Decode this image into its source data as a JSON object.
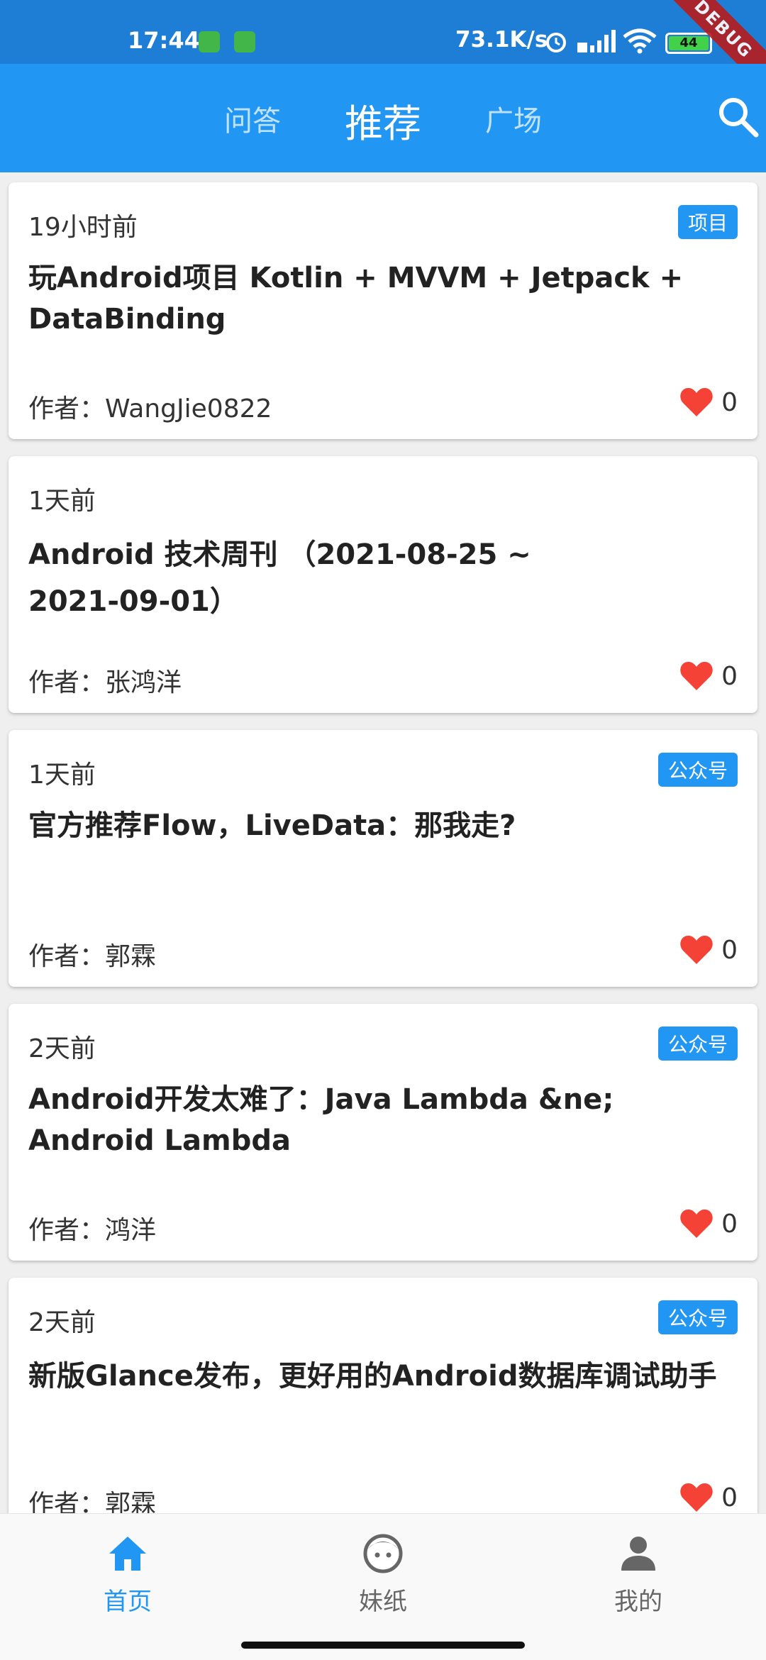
{
  "status_bar": {
    "time": "17:44",
    "network_speed": "73.1K/s",
    "battery": "44",
    "debug_label": "DEBUG"
  },
  "app_bar": {
    "tabs": [
      {
        "label": "问答"
      },
      {
        "label": "推荐"
      },
      {
        "label": "广场"
      }
    ],
    "active_tab": "推荐",
    "search_icon": "search-icon"
  },
  "articles": [
    {
      "time": "19小时前",
      "tag": "项目",
      "title": "玩Android项目 Kotlin + MVVM + Jetpack + DataBinding",
      "author": "作者：WangJie0822",
      "likes": "0"
    },
    {
      "time": "1天前",
      "tag": "",
      "title": "Android 技术周刊 （2021-08-25 ~ 2021-09-01）",
      "author": "作者：张鸿洋",
      "likes": "0"
    },
    {
      "time": "1天前",
      "tag": "公众号",
      "title": "官方推荐Flow，LiveData：那我走?",
      "author": "作者：郭霖",
      "likes": "0"
    },
    {
      "time": "2天前",
      "tag": "公众号",
      "title": "Android开发太难了：Java Lambda &ne; Android Lambda",
      "author": "作者：鸿洋",
      "likes": "0"
    },
    {
      "time": "2天前",
      "tag": "公众号",
      "title": "新版Glance发布，更好用的Android数据库调试助手",
      "author": "作者：郭霖",
      "likes": "0"
    }
  ],
  "bottom_nav": {
    "items": [
      {
        "label": "首页",
        "icon": "home-icon"
      },
      {
        "label": "妹纸",
        "icon": "face-icon"
      },
      {
        "label": "我的",
        "icon": "person-icon"
      }
    ],
    "active": "首页"
  },
  "colors": {
    "primary": "#2196f3",
    "status_bar": "#1e7ed6",
    "heart": "#f44336",
    "active_nav": "#2196f3"
  }
}
